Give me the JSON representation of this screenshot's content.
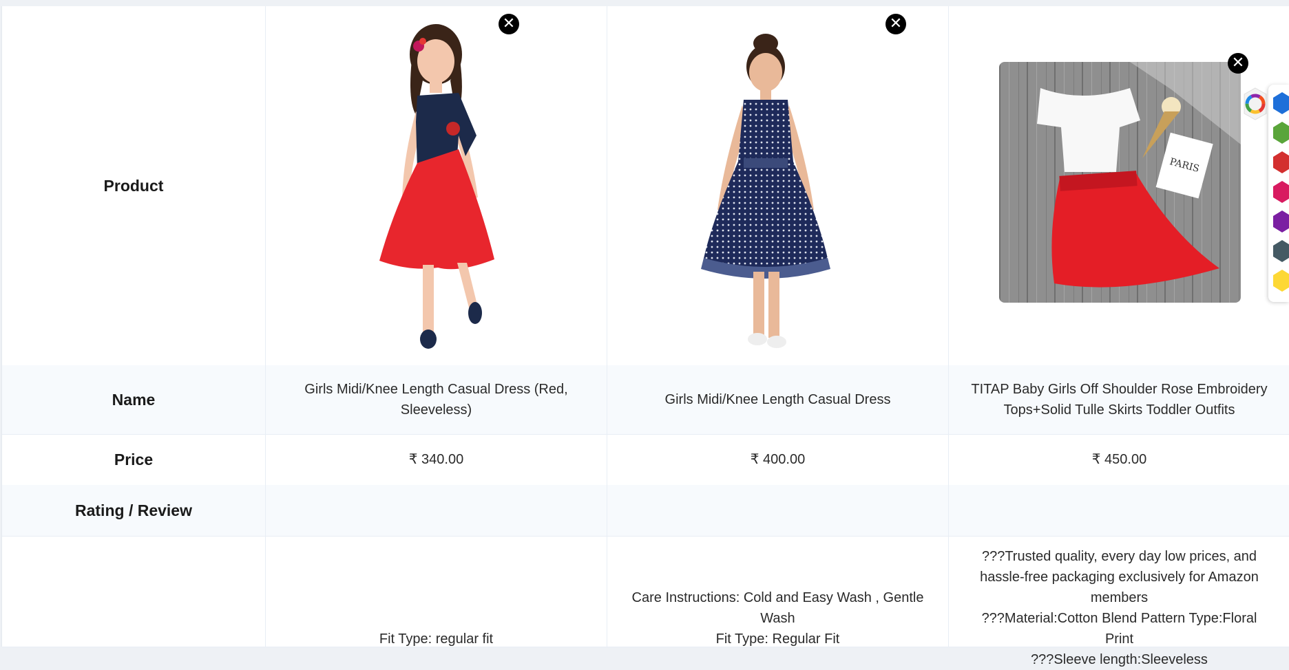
{
  "rows": {
    "product_label": "Product",
    "name_label": "Name",
    "price_label": "Price",
    "rating_label": "Rating / Review"
  },
  "products": [
    {
      "name": "Girls Midi/Knee Length Casual Dress (Red, Sleeveless)",
      "price": "₹ 340.00",
      "rating": "",
      "description_lines": [
        "Fit Type: regular fit"
      ]
    },
    {
      "name": "Girls Midi/Knee Length Casual Dress",
      "price": "₹ 400.00",
      "rating": "",
      "description_lines": [
        "Care Instructions: Cold and Easy Wash , Gentle Wash",
        "Fit Type: Regular Fit"
      ]
    },
    {
      "name": "TITAP Baby Girls Off Shoulder Rose Embroidery Tops+Solid Tulle Skirts Toddler Outfits",
      "price": "₹ 450.00",
      "rating": "",
      "description_lines": [
        "???Trusted quality, every day low prices, and hassle-free packaging exclusively for Amazon members",
        "???Material:Cotton Blend Pattern Type:Floral Print",
        "???Sleeve length:Sleeveless"
      ]
    }
  ],
  "product3_image_text": "PARIS",
  "close_symbol": "✕",
  "palette": {
    "icon": "color-wheel-icon",
    "swatches": [
      "#1e6fd9",
      "#5aa53a",
      "#d32f2f",
      "#d81b60",
      "#7b1fa2",
      "#455a64",
      "#fdd835"
    ]
  }
}
